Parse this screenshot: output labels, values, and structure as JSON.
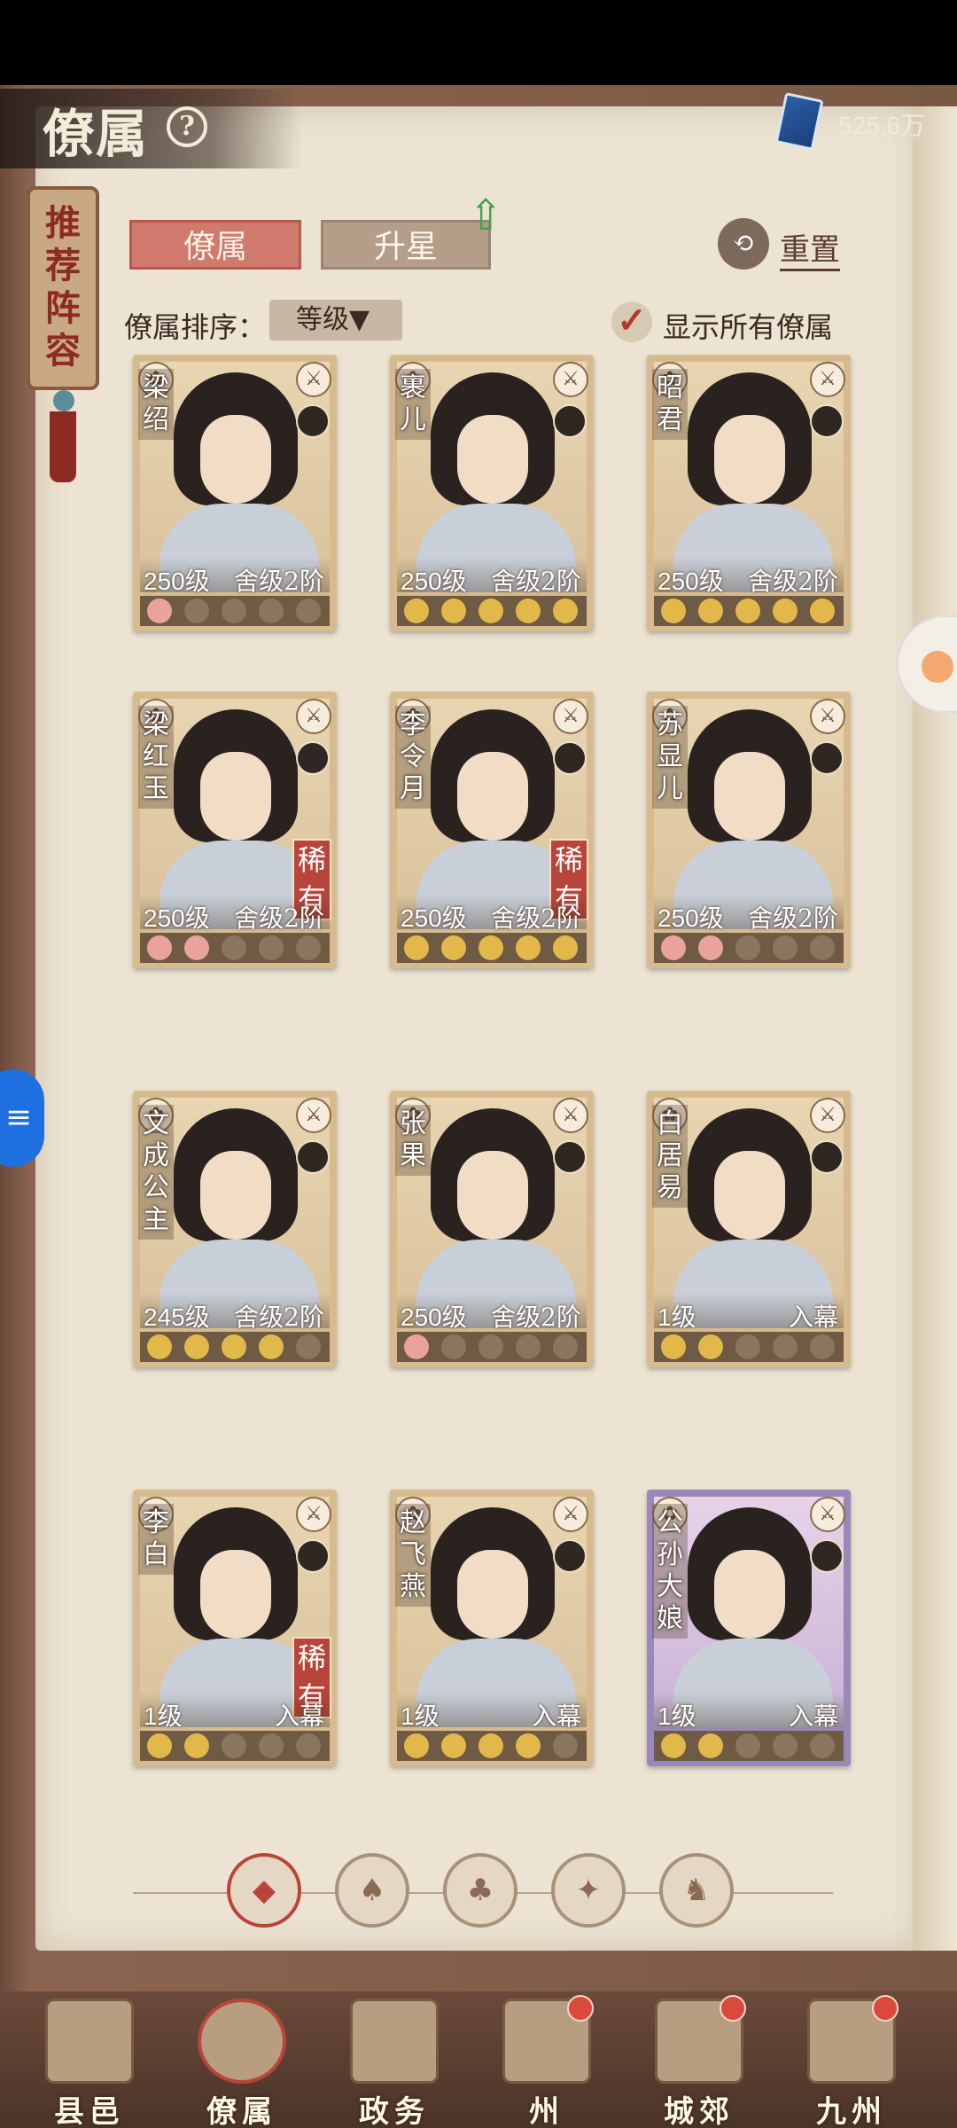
{
  "header": {
    "title": "僚属",
    "help_glyph": "?",
    "currency": "525.6万"
  },
  "recommend_tag": "推荐阵容",
  "tabs": [
    {
      "label": "僚属",
      "active": true
    },
    {
      "label": "升星",
      "active": false
    }
  ],
  "reset_label": "重置",
  "sort": {
    "label": "僚属排序：",
    "value": "等级▼"
  },
  "show_all": {
    "label": "显示所有僚属",
    "checked": true,
    "check_glyph": "✓"
  },
  "cards": [
    {
      "name": "梁绍",
      "level": "250级",
      "rank": "舍级2阶",
      "rare": false,
      "moons": [
        "pink",
        "empty",
        "empty",
        "empty",
        "empty"
      ],
      "frame": "normal"
    },
    {
      "name": "裹儿",
      "level": "250级",
      "rank": "舍级2阶",
      "rare": false,
      "moons": [
        "gold",
        "gold",
        "gold",
        "gold",
        "gold"
      ],
      "frame": "normal"
    },
    {
      "name": "昭君",
      "level": "250级",
      "rank": "舍级2阶",
      "rare": false,
      "moons": [
        "gold",
        "gold",
        "gold",
        "gold",
        "gold"
      ],
      "frame": "normal"
    },
    {
      "name": "梁红玉",
      "level": "250级",
      "rank": "舍级2阶",
      "rare": true,
      "moons": [
        "pink",
        "pink",
        "empty",
        "empty",
        "empty"
      ],
      "frame": "normal"
    },
    {
      "name": "李令月",
      "level": "250级",
      "rank": "舍级2阶",
      "rare": true,
      "moons": [
        "gold",
        "gold",
        "gold",
        "gold",
        "gold"
      ],
      "frame": "normal"
    },
    {
      "name": "苏显儿",
      "level": "250级",
      "rank": "舍级2阶",
      "rare": false,
      "moons": [
        "pink",
        "pink",
        "empty",
        "empty",
        "empty"
      ],
      "frame": "normal"
    },
    {
      "name": "文成公主",
      "level": "245级",
      "rank": "舍级2阶",
      "rare": false,
      "moons": [
        "gold",
        "gold",
        "gold",
        "gold",
        "empty"
      ],
      "frame": "normal"
    },
    {
      "name": "张果",
      "level": "250级",
      "rank": "舍级2阶",
      "rare": false,
      "moons": [
        "pink",
        "empty",
        "empty",
        "empty",
        "empty"
      ],
      "frame": "normal"
    },
    {
      "name": "白居易",
      "level": "1级",
      "rank": "入幕",
      "rare": false,
      "moons": [
        "gold",
        "gold",
        "empty",
        "empty",
        "empty"
      ],
      "frame": "normal"
    },
    {
      "name": "李白",
      "level": "1级",
      "rank": "入幕",
      "rare": true,
      "moons": [
        "gold",
        "gold",
        "empty",
        "empty",
        "empty"
      ],
      "frame": "normal"
    },
    {
      "name": "赵飞燕",
      "level": "1级",
      "rank": "入幕",
      "rare": false,
      "moons": [
        "gold",
        "gold",
        "gold",
        "gold",
        "empty"
      ],
      "frame": "normal"
    },
    {
      "name": "公孙大娘",
      "level": "1级",
      "rank": "入幕",
      "rare": false,
      "moons": [
        "gold",
        "gold",
        "empty",
        "empty",
        "empty"
      ],
      "frame": "epic"
    }
  ],
  "rare_label": "稀有",
  "filters": [
    {
      "icon": "all-filter-icon",
      "glyph": "◆",
      "active": true
    },
    {
      "icon": "bell-filter-icon",
      "glyph": "♠",
      "active": false
    },
    {
      "icon": "gourd-filter-icon",
      "glyph": "♣",
      "active": false
    },
    {
      "icon": "fan-filter-icon",
      "glyph": "✦",
      "active": false
    },
    {
      "icon": "beast-filter-icon",
      "glyph": "♞",
      "active": false
    }
  ],
  "nav": [
    {
      "label": "县邑",
      "active": false,
      "dot": false
    },
    {
      "label": "僚属",
      "active": true,
      "dot": false
    },
    {
      "label": "政务",
      "active": false,
      "dot": false
    },
    {
      "label": "州",
      "active": false,
      "dot": true
    },
    {
      "label": "城郊",
      "active": false,
      "dot": true
    },
    {
      "label": "九州",
      "active": false,
      "dot": true
    }
  ]
}
